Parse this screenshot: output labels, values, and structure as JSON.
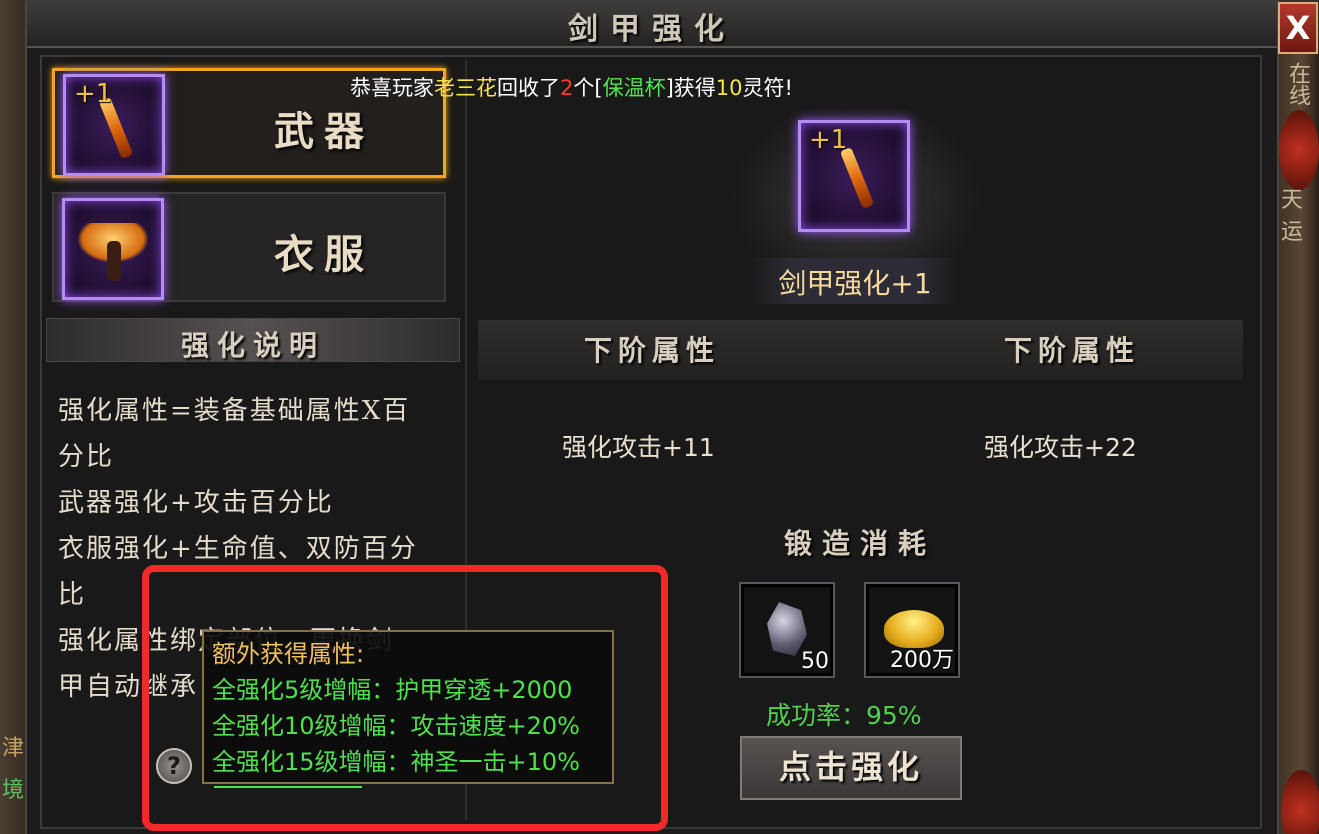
{
  "window": {
    "title": "剑甲强化",
    "close_label": "X"
  },
  "background": {
    "right_text_top": "在线",
    "right_text_mid": "天运",
    "left_text_1": "津",
    "left_text_2": "境"
  },
  "notice": {
    "prefix": "恭喜玩家",
    "player": "老三花",
    "mid1": "回收了",
    "count": "2",
    "mid2": "个[",
    "item": "保温杯",
    "mid3": "]获得",
    "reward": "10",
    "suffix": "灵符!"
  },
  "tabs": [
    {
      "label": "武器",
      "plus": "+1",
      "active": true,
      "icon": "sword-icon"
    },
    {
      "label": "衣服",
      "plus": "",
      "active": false,
      "icon": "wings-armor-icon"
    }
  ],
  "description": {
    "heading": "强化说明",
    "lines": [
      "强化属性=装备基础属性X百",
      "分比",
      "武器强化+攻击百分比",
      "衣服强化+生命值、双防百分",
      "比",
      "强化属性绑定部位，更换剑",
      "甲自动继承"
    ]
  },
  "equip": {
    "plus": "+1",
    "level_label": "剑甲强化+1"
  },
  "attributes": {
    "left_heading": "下阶属性",
    "right_heading": "下阶属性",
    "left_value": "强化攻击+11",
    "right_value": "强化攻击+22"
  },
  "cost": {
    "heading": "锻造消耗",
    "items": [
      {
        "icon": "ore-icon",
        "count": "50"
      },
      {
        "icon": "gold-ingot-icon",
        "count": "200万"
      }
    ],
    "success_rate": "成功率：95%"
  },
  "forge_button": "点击强化",
  "help_icon": "?",
  "tooltip": {
    "title": "额外获得属性:",
    "lines": [
      "全强化5级增幅：护甲穿透+2000",
      "全强化10级增幅：攻击速度+20%",
      "全强化15级增幅：神圣一击+10%"
    ]
  },
  "colors": {
    "accent_gold": "#f0a820",
    "highlight_red": "#f02a2a",
    "success_green": "#4fd14f",
    "item_frame_purple": "#b58cf2"
  }
}
